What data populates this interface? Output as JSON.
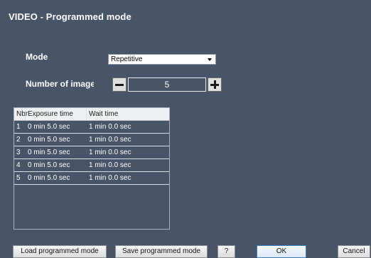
{
  "window": {
    "title": "VIDEO - Programmed mode"
  },
  "form": {
    "mode_label": "Mode",
    "mode_value": "Repetitive",
    "number_label": "Number of images",
    "number_value": "5"
  },
  "table": {
    "headers": [
      "Nbr",
      "Exposure time",
      "Wait time"
    ],
    "rows": [
      [
        "1",
        "0 min 5.0 sec",
        "1 min 0.0 sec"
      ],
      [
        "2",
        "0 min 5.0 sec",
        "1 min 0.0 sec"
      ],
      [
        "3",
        "0 min 5.0 sec",
        "1 min 0.0 sec"
      ],
      [
        "4",
        "0 min 5.0 sec",
        "1 min 0.0 sec"
      ],
      [
        "5",
        "0 min 5.0 sec",
        "1 min 0.0 sec"
      ]
    ]
  },
  "buttons": {
    "load": "Load programmed mode",
    "save": "Save programmed mode",
    "help": "?",
    "ok": "OK",
    "cancel": "Cancel"
  },
  "icons": {
    "dropdown": "chevron-down-icon",
    "decrement": "minus-icon",
    "increment": "plus-icon"
  },
  "colors": {
    "background": "#485467",
    "text": "#ffffff",
    "header_bg": "#eef0f2",
    "ok_border": "#3b7fc4"
  }
}
